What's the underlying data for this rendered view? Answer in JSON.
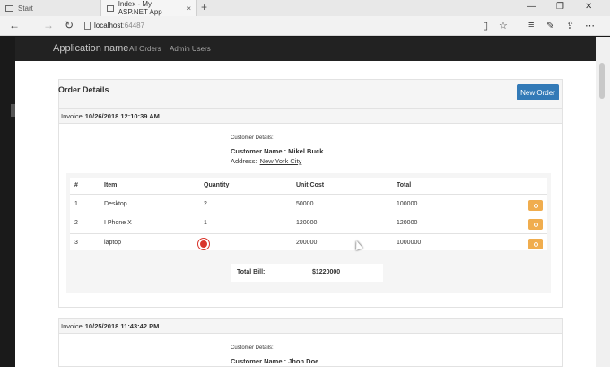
{
  "browser": {
    "tabs": [
      {
        "label": "Start"
      },
      {
        "label": "Index - My ASP.NET App"
      }
    ],
    "url_host": "localhost",
    "url_port": ":64487",
    "new_tab": "+",
    "close_tab": "×"
  },
  "navbar": {
    "brand": "Application name",
    "links": [
      "All Orders",
      "Admin Users"
    ]
  },
  "panel": {
    "title": "Order Details",
    "new_order_button": "New Order"
  },
  "invoices": [
    {
      "label": "Invoice",
      "date": "10/26/2018 12:10:39 AM",
      "customer_details_label": "Customer Details:",
      "customer_name": "Customer Name : Mikel Buck",
      "address_label": "Address:",
      "address_value": "New York City",
      "columns": [
        "#",
        "Item",
        "Quantity",
        "Unit Cost",
        "Total"
      ],
      "rows": [
        {
          "num": "1",
          "item": "Desktop",
          "qty": "2",
          "unit": "50000",
          "total": "100000"
        },
        {
          "num": "2",
          "item": "I Phone X",
          "qty": "1",
          "unit": "120000",
          "total": "120000"
        },
        {
          "num": "3",
          "item": "laptop",
          "qty": "",
          "unit": "200000",
          "total": "1000000"
        }
      ],
      "total_bill_label": "Total Bill:",
      "total_bill_value": "$1220000"
    },
    {
      "label": "Invoice",
      "date": "10/25/2018 11:43:42 PM",
      "customer_details_label": "Customer Details:",
      "customer_name": "Customer Name : Jhon Doe"
    }
  ],
  "colors": {
    "primary": "#337ab7",
    "warning": "#f0ad4e",
    "navbar": "#222222"
  }
}
